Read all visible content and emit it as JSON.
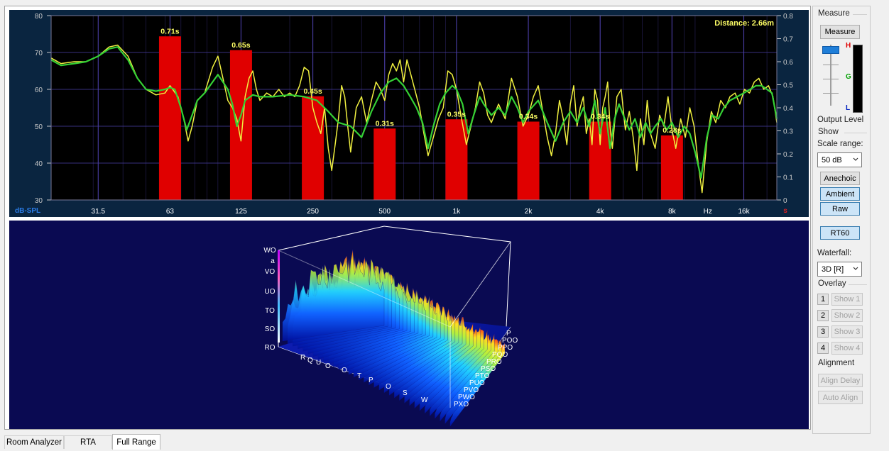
{
  "chart_data": {
    "type": "line",
    "distance_label": "Distance: 2.66m",
    "left_axis_label": "dB-SPL",
    "right_axis_unit": "s",
    "x_unit_label": "Hz",
    "y_left": {
      "min": 30,
      "max": 80,
      "ticks": [
        "30",
        "40",
        "50",
        "60",
        "70",
        "80"
      ]
    },
    "y_right": {
      "min": 0,
      "max": 0.8,
      "ticks": [
        "0",
        "0.1",
        "0.2",
        "0.3",
        "0.4",
        "0.5",
        "0.6",
        "0.7",
        "0.8"
      ]
    },
    "x_log_range": [
      20,
      22000
    ],
    "x_ticks": [
      {
        "f": 31.5,
        "label": "31.5"
      },
      {
        "f": 63,
        "label": "63"
      },
      {
        "f": 125,
        "label": "125"
      },
      {
        "f": 250,
        "label": "250"
      },
      {
        "f": 500,
        "label": "500"
      },
      {
        "f": 1000,
        "label": "1k"
      },
      {
        "f": 2000,
        "label": "2k"
      },
      {
        "f": 4000,
        "label": "4k"
      },
      {
        "f": 8000,
        "label": "8k"
      },
      {
        "f": 16000,
        "label": "16k"
      }
    ],
    "rt60_bars": [
      {
        "f": 63,
        "value": 0.71,
        "label": "0.71s"
      },
      {
        "f": 125,
        "value": 0.65,
        "label": "0.65s"
      },
      {
        "f": 250,
        "value": 0.45,
        "label": "0.45s"
      },
      {
        "f": 500,
        "value": 0.31,
        "label": "0.31s"
      },
      {
        "f": 1000,
        "value": 0.35,
        "label": "0.35s"
      },
      {
        "f": 2000,
        "value": 0.34,
        "label": "0.34s"
      },
      {
        "f": 4000,
        "value": 0.34,
        "label": "0.34s"
      },
      {
        "f": 8000,
        "value": 0.28,
        "label": "0.28s"
      }
    ],
    "series": [
      {
        "color": "#f0f040",
        "points": [
          [
            20,
            68.5
          ],
          [
            22,
            67
          ],
          [
            25,
            67.5
          ],
          [
            28,
            67.5
          ],
          [
            31.5,
            69
          ],
          [
            35,
            71.5
          ],
          [
            38,
            72
          ],
          [
            42,
            69
          ],
          [
            46,
            63
          ],
          [
            50,
            60
          ],
          [
            55,
            58.5
          ],
          [
            60,
            59
          ],
          [
            63,
            61
          ],
          [
            68,
            58
          ],
          [
            72,
            52
          ],
          [
            75,
            46
          ],
          [
            78,
            50
          ],
          [
            82,
            57
          ],
          [
            88,
            59
          ],
          [
            95,
            66
          ],
          [
            100,
            69
          ],
          [
            105,
            63
          ],
          [
            110,
            57
          ],
          [
            115,
            55
          ],
          [
            120,
            52
          ],
          [
            125,
            46
          ],
          [
            130,
            58
          ],
          [
            135,
            63
          ],
          [
            140,
            65
          ],
          [
            145,
            60
          ],
          [
            150,
            57
          ],
          [
            160,
            59
          ],
          [
            170,
            58
          ],
          [
            180,
            60
          ],
          [
            190,
            58
          ],
          [
            200,
            59
          ],
          [
            210,
            58
          ],
          [
            220,
            61
          ],
          [
            230,
            66
          ],
          [
            240,
            65
          ],
          [
            250,
            55
          ],
          [
            260,
            51
          ],
          [
            270,
            48
          ],
          [
            280,
            55
          ],
          [
            290,
            44
          ],
          [
            300,
            38
          ],
          [
            310,
            45
          ],
          [
            320,
            52
          ],
          [
            330,
            61
          ],
          [
            340,
            58
          ],
          [
            350,
            50
          ],
          [
            360,
            43
          ],
          [
            380,
            55
          ],
          [
            400,
            58
          ],
          [
            420,
            51
          ],
          [
            440,
            57
          ],
          [
            460,
            62
          ],
          [
            480,
            60
          ],
          [
            500,
            57
          ],
          [
            520,
            64
          ],
          [
            540,
            67
          ],
          [
            560,
            65
          ],
          [
            580,
            68
          ],
          [
            600,
            62
          ],
          [
            620,
            68
          ],
          [
            650,
            63
          ],
          [
            700,
            55
          ],
          [
            730,
            48
          ],
          [
            760,
            42
          ],
          [
            800,
            47
          ],
          [
            840,
            52
          ],
          [
            880,
            55
          ],
          [
            920,
            65
          ],
          [
            960,
            64
          ],
          [
            1000,
            60
          ],
          [
            1050,
            52
          ],
          [
            1100,
            45
          ],
          [
            1150,
            50
          ],
          [
            1200,
            55
          ],
          [
            1250,
            62
          ],
          [
            1300,
            59
          ],
          [
            1350,
            53
          ],
          [
            1400,
            51
          ],
          [
            1500,
            56
          ],
          [
            1600,
            52
          ],
          [
            1700,
            63
          ],
          [
            1800,
            58
          ],
          [
            1900,
            50
          ],
          [
            2000,
            53
          ],
          [
            2100,
            58
          ],
          [
            2200,
            61
          ],
          [
            2300,
            54
          ],
          [
            2400,
            47
          ],
          [
            2500,
            42
          ],
          [
            2600,
            48
          ],
          [
            2700,
            57
          ],
          [
            2800,
            52
          ],
          [
            2900,
            45
          ],
          [
            3000,
            56
          ],
          [
            3100,
            61
          ],
          [
            3200,
            50
          ],
          [
            3300,
            55
          ],
          [
            3400,
            58
          ],
          [
            3500,
            48
          ],
          [
            3600,
            52
          ],
          [
            3700,
            45
          ],
          [
            3800,
            60
          ],
          [
            3900,
            57
          ],
          [
            4000,
            45
          ],
          [
            4100,
            55
          ],
          [
            4200,
            58
          ],
          [
            4300,
            62
          ],
          [
            4400,
            50
          ],
          [
            4500,
            44
          ],
          [
            4700,
            58
          ],
          [
            4900,
            60
          ],
          [
            5100,
            49
          ],
          [
            5300,
            54
          ],
          [
            5500,
            47
          ],
          [
            5700,
            38
          ],
          [
            5900,
            52
          ],
          [
            6100,
            45
          ],
          [
            6300,
            57
          ],
          [
            6500,
            48
          ],
          [
            6800,
            44
          ],
          [
            7100,
            53
          ],
          [
            7400,
            50
          ],
          [
            7700,
            58
          ],
          [
            8000,
            49
          ],
          [
            8300,
            44
          ],
          [
            8700,
            52
          ],
          [
            9100,
            47
          ],
          [
            9500,
            55
          ],
          [
            9900,
            50
          ],
          [
            10300,
            40
          ],
          [
            10700,
            32
          ],
          [
            11200,
            46
          ],
          [
            11700,
            54
          ],
          [
            12200,
            51
          ],
          [
            12800,
            57
          ],
          [
            13400,
            55
          ],
          [
            14000,
            58
          ],
          [
            14700,
            59
          ],
          [
            15400,
            56
          ],
          [
            16100,
            60
          ],
          [
            16900,
            59
          ],
          [
            17700,
            62
          ],
          [
            18500,
            63
          ],
          [
            19400,
            60
          ],
          [
            20300,
            61
          ],
          [
            21200,
            58
          ],
          [
            22000,
            51
          ]
        ]
      },
      {
        "color": "#35d135",
        "points": [
          [
            20,
            68
          ],
          [
            22,
            66.5
          ],
          [
            25,
            67
          ],
          [
            28,
            67.5
          ],
          [
            31.5,
            69
          ],
          [
            35,
            71
          ],
          [
            38,
            71.5
          ],
          [
            42,
            68
          ],
          [
            46,
            63
          ],
          [
            50,
            60
          ],
          [
            55,
            59.5
          ],
          [
            60,
            60
          ],
          [
            63,
            60.5
          ],
          [
            66,
            60
          ],
          [
            70,
            55
          ],
          [
            74,
            49
          ],
          [
            78,
            53
          ],
          [
            82,
            57
          ],
          [
            88,
            59
          ],
          [
            95,
            62
          ],
          [
            100,
            64
          ],
          [
            105,
            62
          ],
          [
            110,
            60
          ],
          [
            115,
            56
          ],
          [
            120,
            50
          ],
          [
            125,
            53
          ],
          [
            130,
            57
          ],
          [
            140,
            58.5
          ],
          [
            150,
            58
          ],
          [
            170,
            58
          ],
          [
            200,
            58.5
          ],
          [
            230,
            58
          ],
          [
            260,
            57
          ],
          [
            290,
            54
          ],
          [
            320,
            51
          ],
          [
            360,
            50
          ],
          [
            400,
            47
          ],
          [
            440,
            54
          ],
          [
            480,
            59
          ],
          [
            520,
            62
          ],
          [
            560,
            63
          ],
          [
            600,
            61
          ],
          [
            640,
            58
          ],
          [
            680,
            55
          ],
          [
            720,
            51
          ],
          [
            760,
            44
          ],
          [
            800,
            50
          ],
          [
            850,
            56
          ],
          [
            900,
            59
          ],
          [
            960,
            61
          ],
          [
            1000,
            60
          ],
          [
            1060,
            56
          ],
          [
            1120,
            48
          ],
          [
            1180,
            53
          ],
          [
            1250,
            58
          ],
          [
            1300,
            56
          ],
          [
            1400,
            53
          ],
          [
            1500,
            55
          ],
          [
            1600,
            53
          ],
          [
            1700,
            58
          ],
          [
            1800,
            55
          ],
          [
            1900,
            51
          ],
          [
            2000,
            54
          ],
          [
            2200,
            57
          ],
          [
            2400,
            51
          ],
          [
            2600,
            46
          ],
          [
            2800,
            51
          ],
          [
            3000,
            54
          ],
          [
            3200,
            51
          ],
          [
            3400,
            55
          ],
          [
            3600,
            50
          ],
          [
            3800,
            57
          ],
          [
            4000,
            48
          ],
          [
            4200,
            55
          ],
          [
            4400,
            44
          ],
          [
            4600,
            52
          ],
          [
            4800,
            56
          ],
          [
            5000,
            53
          ],
          [
            5300,
            49
          ],
          [
            5600,
            52
          ],
          [
            5900,
            47
          ],
          [
            6200,
            51
          ],
          [
            6500,
            48
          ],
          [
            6800,
            50
          ],
          [
            7200,
            52
          ],
          [
            7600,
            49
          ],
          [
            8000,
            51
          ],
          [
            8500,
            47
          ],
          [
            9000,
            50
          ],
          [
            9500,
            48
          ],
          [
            10000,
            43
          ],
          [
            10600,
            36
          ],
          [
            11200,
            47
          ],
          [
            11800,
            53
          ],
          [
            12500,
            52
          ],
          [
            13200,
            55
          ],
          [
            14000,
            57
          ],
          [
            15000,
            58
          ],
          [
            16000,
            59
          ],
          [
            17000,
            60
          ],
          [
            18000,
            61
          ],
          [
            19000,
            61
          ],
          [
            20000,
            60
          ],
          [
            21000,
            59
          ],
          [
            22000,
            52
          ]
        ]
      }
    ]
  },
  "waterfall": {
    "scale_labels": [
      "WO",
      "a",
      "VO",
      "UO",
      "TO",
      "SO",
      "RO"
    ]
  },
  "sidebar": {
    "measure_group": "Measure",
    "measure_button": "Measure",
    "level_labels": {
      "high": "H",
      "good": "G",
      "low": "L"
    },
    "output_level_label": "Output Level",
    "show_group": "Show",
    "scale_range_label": "Scale range:",
    "scale_range_value": "50 dB",
    "anechoic_button": "Anechoic",
    "ambient_button": "Ambient",
    "raw_button": "Raw",
    "rt60_button": "RT60",
    "waterfall_label": "Waterfall:",
    "waterfall_value": "3D [R]",
    "overlay_group": "Overlay",
    "overlay_nums": [
      "1",
      "2",
      "3",
      "4"
    ],
    "overlay_shows": [
      "Show 1",
      "Show 2",
      "Show 3",
      "Show 4"
    ],
    "alignment_group": "Alignment",
    "align_delay_button": "Align Delay",
    "auto_align_button": "Auto Align"
  },
  "tabs": [
    "Room Analyzer",
    "RTA",
    "Full Range"
  ],
  "active_tab": "Full Range",
  "colors": {
    "plot_bg": "#000000",
    "panel_bg": "#0a2540",
    "bar": "#e00000",
    "bar_label": "#ffff66",
    "grid": "#4b3fa8",
    "waterfall_bg": "#0a0a52",
    "accent": "#0078d7"
  }
}
